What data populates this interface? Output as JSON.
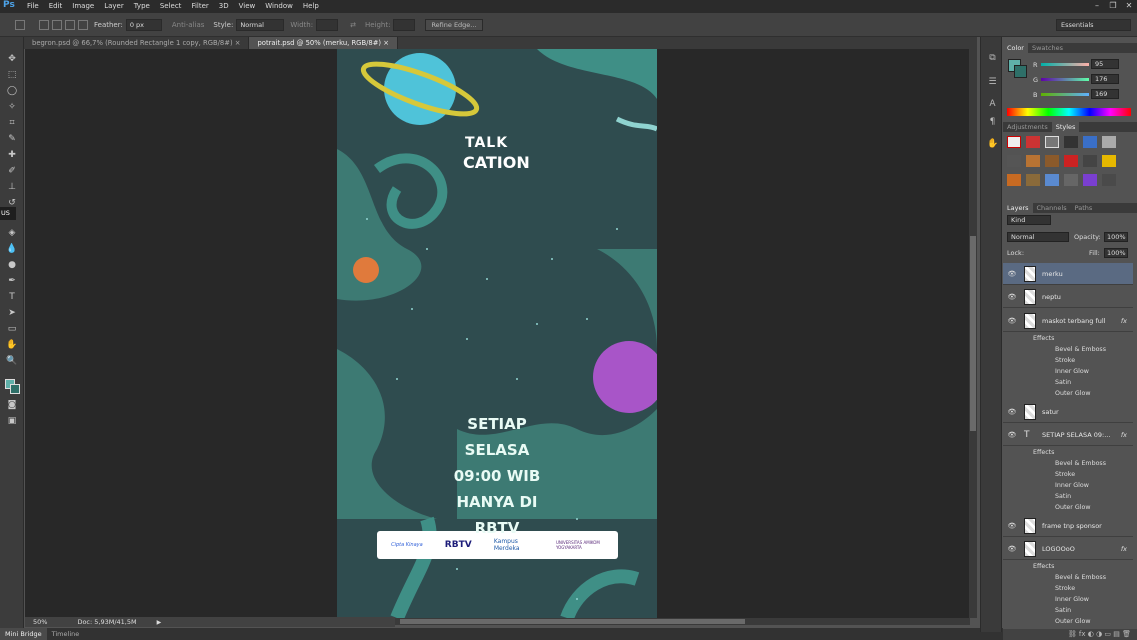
{
  "app": {
    "logo": "Ps"
  },
  "menu": [
    "File",
    "Edit",
    "Image",
    "Layer",
    "Type",
    "Select",
    "Filter",
    "3D",
    "View",
    "Window",
    "Help"
  ],
  "options": {
    "feather_label": "Feather:",
    "feather_value": "0 px",
    "antialias_label": "Anti-alias",
    "style_label": "Style:",
    "style_value": "Normal",
    "width_label": "Width:",
    "height_label": "Height:",
    "refine_label": "Refine Edge...",
    "workspace": "Essentials"
  },
  "tabs": [
    {
      "label": "begron.psd @ 66,7% (Rounded Rectangle 1 copy, RGB/8#)",
      "close": "×"
    },
    {
      "label": "potrait.psd @ 50% (merku, RGB/8#)",
      "close": "×"
    }
  ],
  "tool_tooltip": "US",
  "status": {
    "zoom": "50%",
    "doc": "Doc: 5,93M/41,5M"
  },
  "bottom_tabs": [
    "Mini Bridge",
    "Timeline"
  ],
  "color_panel": {
    "tabs": [
      "Color",
      "Swatches"
    ],
    "r_label": "R",
    "r": "95",
    "g_label": "G",
    "g": "176",
    "b_label": "B",
    "b": "169",
    "fg_color": "#5fb0a9"
  },
  "styles_panel": {
    "tabs": [
      "Adjustments",
      "Styles"
    ]
  },
  "layers_panel": {
    "tabs": [
      "Layers",
      "Channels",
      "Paths"
    ],
    "kind": "Kind",
    "blend": "Normal",
    "opacity_label": "Opacity:",
    "opacity": "100%",
    "lock_label": "Lock:",
    "fill_label": "Fill:",
    "fill": "100%",
    "layers": [
      {
        "name": "merku"
      },
      {
        "name": "neptu"
      },
      {
        "name": "maskot terbang full",
        "fx": "fx",
        "effects_label": "Effects",
        "effects": [
          "Bevel & Emboss",
          "Stroke",
          "Inner Glow",
          "Satin",
          "Outer Glow"
        ]
      },
      {
        "name": "satur"
      },
      {
        "name": "SETIAP SELASA 09:...",
        "fx": "fx",
        "effects_label": "Effects",
        "effects": [
          "Bevel & Emboss",
          "Stroke",
          "Inner Glow",
          "Satin",
          "Outer Glow"
        ]
      },
      {
        "name": "frame tnp sponsor"
      },
      {
        "name": "LOGOOoO",
        "fx": "fx",
        "effects_label": "Effects",
        "effects": [
          "Bevel & Emboss",
          "Stroke",
          "Inner Glow",
          "Satin",
          "Outer Glow"
        ]
      }
    ]
  },
  "poster": {
    "brand_line1": "TALK",
    "brand_line2": "CATION",
    "headline": [
      "SETIAP SELASA",
      "09:00 WIB",
      "HANYA DI",
      "RBTV"
    ],
    "sponsors": [
      "Cipta Kinaya",
      "RBTV",
      "Kampus Merdeka",
      "UNIVERSITAS AMIKOM YOGYAKARTA"
    ],
    "bg_color": "#2f4c4f",
    "accent_color": "#3f8f86"
  }
}
